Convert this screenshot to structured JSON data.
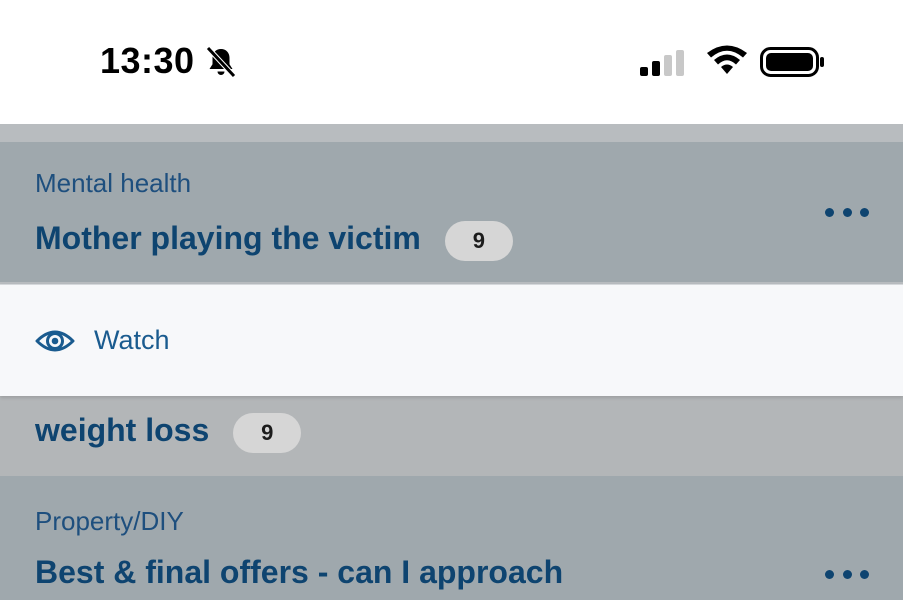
{
  "status_bar": {
    "time": "13:30",
    "icons": [
      "bell-slash-icon",
      "signal-icon",
      "wifi-icon",
      "battery-icon"
    ]
  },
  "threads": [
    {
      "topic": "Mental health",
      "title": "Mother playing the victim",
      "count": "9"
    },
    {
      "title": "weight loss",
      "count": "9"
    },
    {
      "topic": "Property/DIY",
      "title": "Best & final offers - can I approach"
    }
  ],
  "watch_menu": {
    "label": "Watch",
    "icon": "eye-icon"
  },
  "colors": {
    "accent": "#0e4470",
    "overlay_row": "#9fa8ad",
    "menu_bg": "#f7f8fa"
  }
}
